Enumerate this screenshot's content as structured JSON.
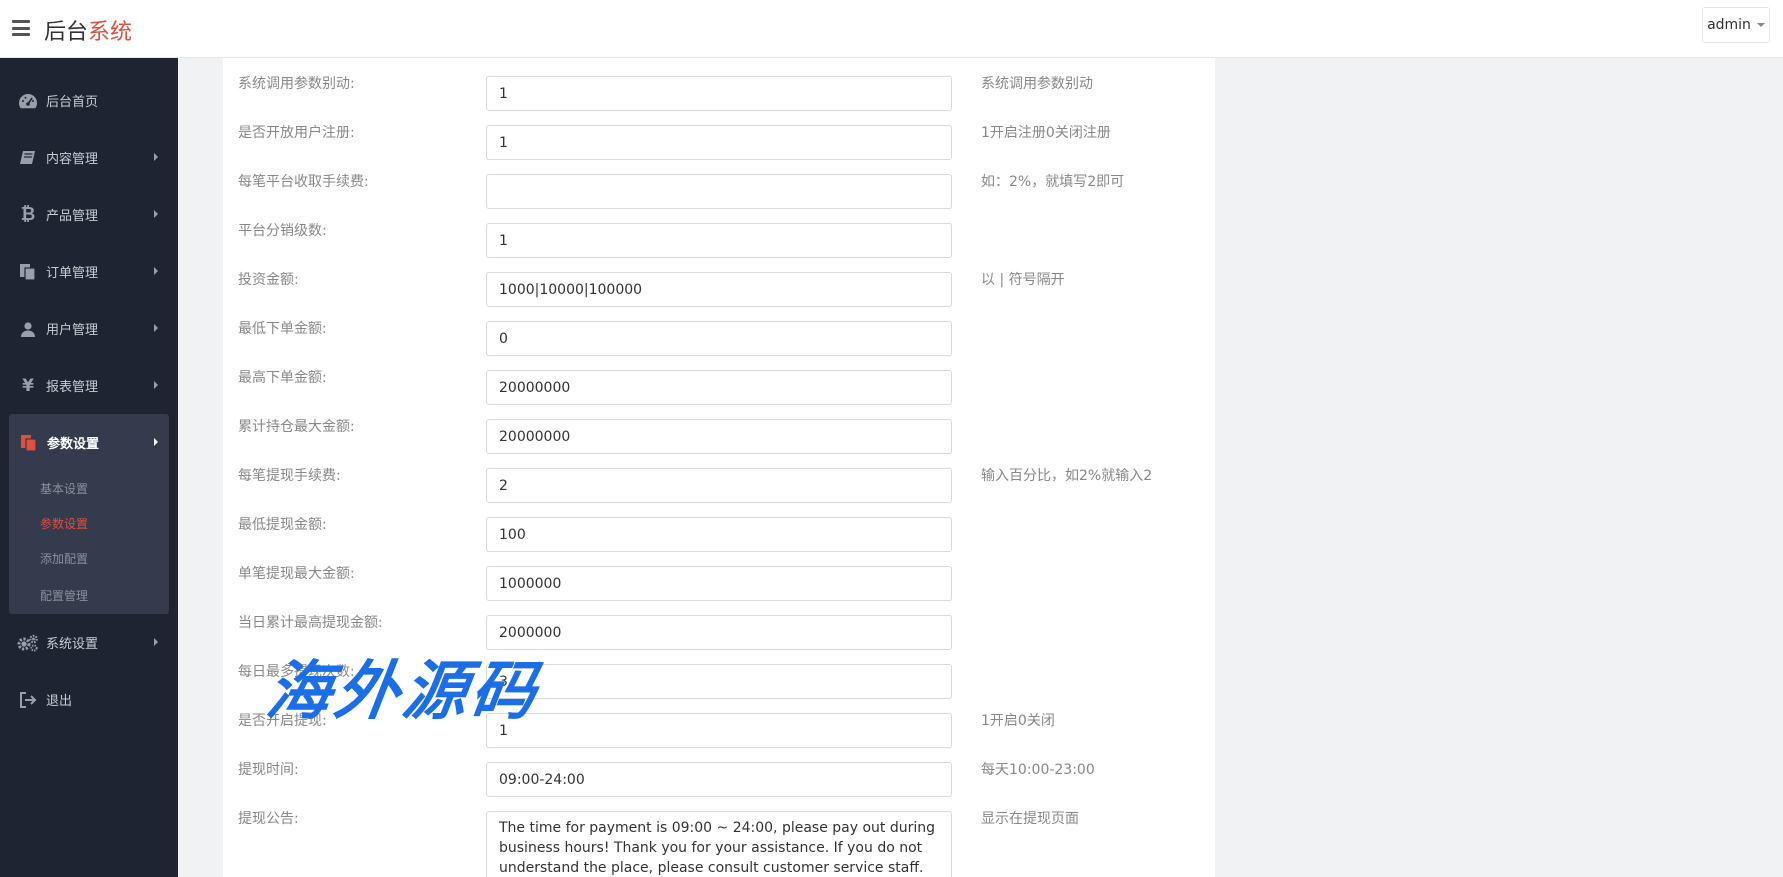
{
  "header": {
    "brand_main": "后台",
    "brand_accent": "系统",
    "user": "admin"
  },
  "sidebar": {
    "items": [
      {
        "label": "后台首页"
      },
      {
        "label": "内容管理"
      },
      {
        "label": "产品管理"
      },
      {
        "label": "订单管理"
      },
      {
        "label": "用户管理"
      },
      {
        "label": "报表管理"
      },
      {
        "label": "参数设置"
      },
      {
        "label": "系统设置"
      },
      {
        "label": "退出"
      }
    ],
    "sub_items": [
      {
        "label": "基本设置"
      },
      {
        "label": "参数设置"
      },
      {
        "label": "添加配置"
      },
      {
        "label": "配置管理"
      }
    ]
  },
  "form": {
    "rows": [
      {
        "label": "系统调用参数别动:",
        "value": "1",
        "hint": "系统调用参数别动"
      },
      {
        "label": "是否开放用户注册:",
        "value": "1",
        "hint": "1开启注册0关闭注册"
      },
      {
        "label": "每笔平台收取手续费:",
        "value": "",
        "hint": "如：2%，就填写2即可"
      },
      {
        "label": "平台分销级数:",
        "value": "1",
        "hint": ""
      },
      {
        "label": "投资金额:",
        "value": "1000|10000|100000",
        "hint": "以 | 符号隔开"
      },
      {
        "label": "最低下单金额:",
        "value": "0",
        "hint": ""
      },
      {
        "label": "最高下单金额:",
        "value": "20000000",
        "hint": ""
      },
      {
        "label": "累计持仓最大金额:",
        "value": "20000000",
        "hint": ""
      },
      {
        "label": "每笔提现手续费:",
        "value": "2",
        "hint": "输入百分比，如2%就输入2"
      },
      {
        "label": "最低提现金额:",
        "value": "100",
        "hint": ""
      },
      {
        "label": "单笔提现最大金额:",
        "value": "1000000",
        "hint": ""
      },
      {
        "label": "当日累计最高提现金额:",
        "value": "2000000",
        "hint": ""
      },
      {
        "label": "每日最多提现次数:",
        "value": "3",
        "hint": ""
      },
      {
        "label": "是否开启提现:",
        "value": "1",
        "hint": "1开启0关闭"
      },
      {
        "label": "提现时间:",
        "value": "09:00-24:00",
        "hint": "每天10:00-23:00"
      }
    ],
    "notice": {
      "label": "提现公告:",
      "value": "The time for payment is 09:00 ~ 24:00, please pay out during business hours! Thank you for your assistance. If you do not understand the place, please consult customer service staff.",
      "hint": "显示在提现页面"
    }
  },
  "watermark": "海外源码"
}
